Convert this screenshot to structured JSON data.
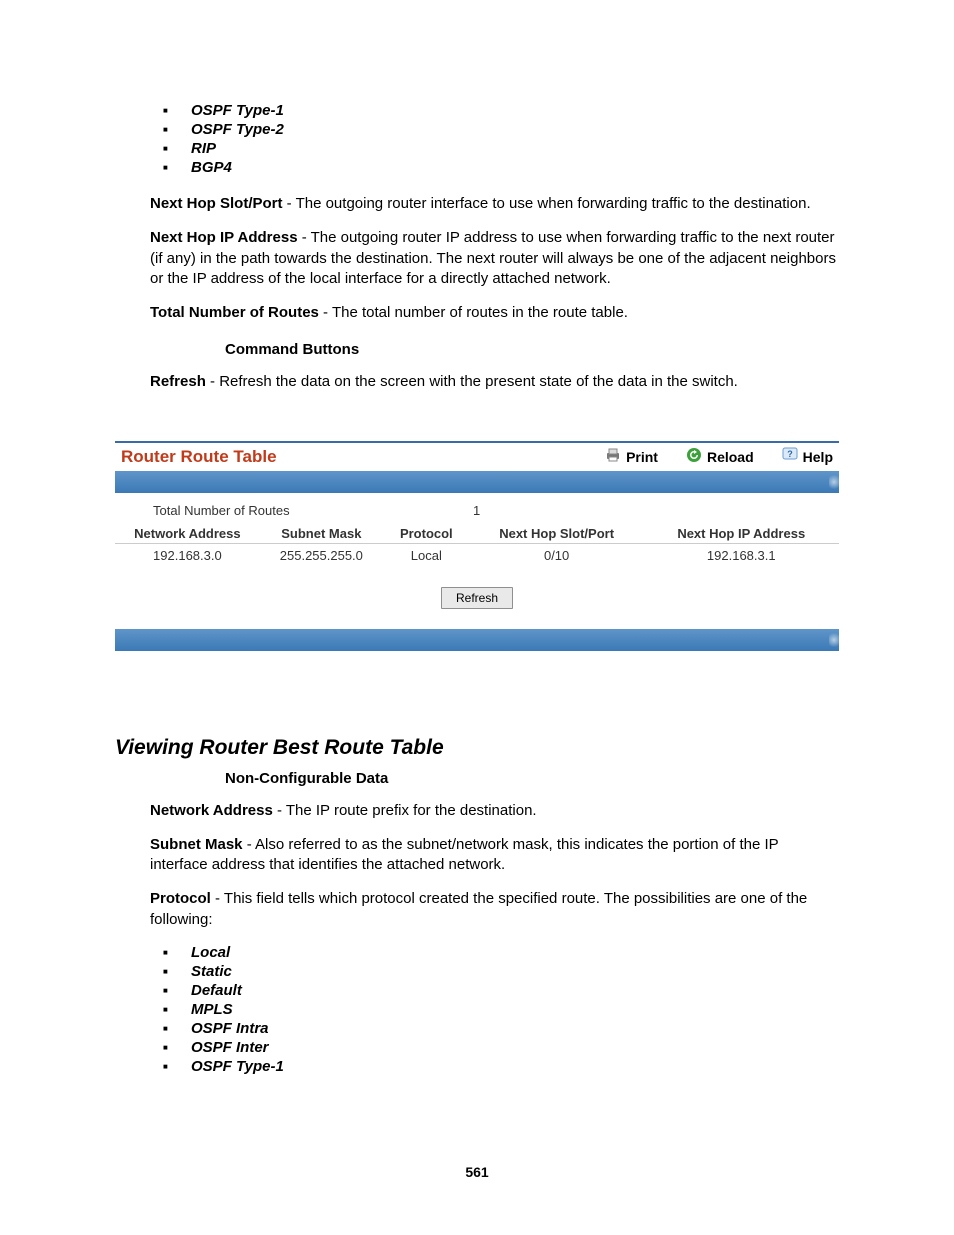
{
  "top_protocols": [
    "OSPF Type-1",
    "OSPF Type-2",
    "RIP",
    "BGP4"
  ],
  "definitions_top": [
    {
      "term": "Next Hop Slot/Port",
      "desc": " - The outgoing router interface to use when forwarding traffic to the destination."
    },
    {
      "term": "Next Hop IP Address",
      "desc": " - The outgoing router IP address to use when forwarding traffic to the next router (if any) in the path towards the destination. The next router will always be one of the adjacent neighbors or the IP address of the local interface for a directly attached network."
    },
    {
      "term": "Total Number of Routes",
      "desc": " - The total number of routes in the route table."
    }
  ],
  "command_buttons_heading": "Command Buttons",
  "refresh_def": {
    "term": "Refresh",
    "desc": " - Refresh the data on the screen with the present state of the data in the switch."
  },
  "panel": {
    "title": "Router Route Table",
    "actions": {
      "print": "Print",
      "reload": "Reload",
      "help": "Help"
    },
    "total_routes_label": "Total Number of Routes",
    "total_routes_value": "1",
    "columns": [
      "Network Address",
      "Subnet Mask",
      "Protocol",
      "Next Hop Slot/Port",
      "Next Hop IP Address"
    ],
    "row": {
      "network_address": "192.168.3.0",
      "subnet_mask": "255.255.255.0",
      "protocol": "Local",
      "next_hop_slot_port": "0/10",
      "next_hop_ip": "192.168.3.1"
    },
    "refresh_button": "Refresh"
  },
  "section2": {
    "title": "Viewing Router Best Route Table",
    "subheading": "Non-Configurable Data",
    "defs": [
      {
        "term": "Network Address",
        "desc": " - The IP route prefix for the destination."
      },
      {
        "term": "Subnet Mask",
        "desc": " - Also referred to as the subnet/network mask, this indicates the portion of the IP interface address that identifies the attached network."
      },
      {
        "term": "Protocol",
        "desc": " - This field tells which protocol created the specified route. The possibilities are one of the following:"
      }
    ],
    "protocols": [
      "Local",
      "Static",
      "Default",
      "MPLS",
      "OSPF Intra",
      "OSPF Inter",
      "OSPF Type-1"
    ]
  },
  "page_number": "561"
}
